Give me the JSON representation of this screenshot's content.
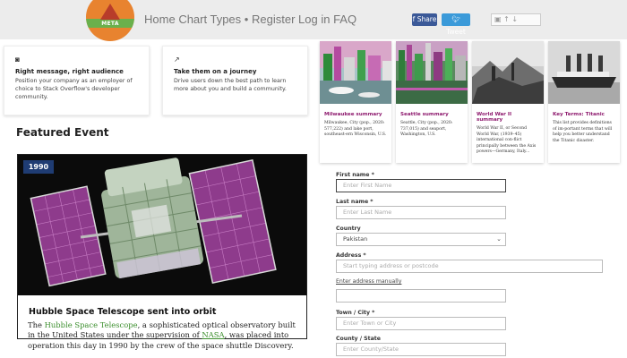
{
  "header": {
    "logo_text": "META",
    "nav": [
      "Home",
      "Chart Types",
      "Register",
      "Log in",
      "FAQ"
    ],
    "share_facebook": "Share",
    "share_twitter": "Tweet",
    "mini_widget": "▣ ↑ ↓"
  },
  "ads": [
    {
      "icon": "camera-icon",
      "title": "Right message, right audience",
      "desc": "Position your company as an employer of choice to Stack Overflow's developer community."
    },
    {
      "icon": "trend-icon",
      "title": "Take them on a journey",
      "desc": "Drive users down the best path to learn more about you and build a community."
    }
  ],
  "thumbnails": [
    {
      "caption": "Milwaukee summary",
      "text": "Milwaukee, City (pop., 2020: 577,222) and lake port, southeast-ern Wisconsin, U.S."
    },
    {
      "caption": "Seattle summary",
      "text": "Seattle, City (pop., 2020: 737,015) and seaport, Washington, U.S."
    },
    {
      "caption": "World War II summary",
      "text": "World War II, or Second World War, (1939–45) international con-flict principally between the Axis powers—Germany, Italy..."
    },
    {
      "caption": "Key Terms: Titanic",
      "text": "This list provides definitions of im-portant terms that will help you better understand the Titanic disaster."
    }
  ],
  "featured": {
    "section_title": "Featured Event",
    "year": "1990",
    "headline": "Hubble Space Telescope sent into orbit",
    "body_prefix": "The ",
    "link_hubble": "Hubble Space Telescope",
    "body_mid": ", a sophisticated optical observatory built in the United States under the supervision of ",
    "link_nasa": "NASA",
    "body_suffix": ", was placed into operation this day in 1990 by the crew of the space shuttle Discovery."
  },
  "form": {
    "first_name_label": "First name *",
    "first_name_placeholder": "Enter First Name",
    "last_name_label": "Last name *",
    "last_name_placeholder": "Enter Last Name",
    "country_label": "Country",
    "country_value": "Pakistan",
    "address_label": "Address *",
    "address_placeholder": "Start typing address or postcode",
    "manual_link": "Enter address manually",
    "city_label": "Town / City *",
    "city_placeholder": "Enter Town or City",
    "county_label": "County / State",
    "county_placeholder": "Enter County/State"
  },
  "colors": {
    "brand_orange": "#e8832f",
    "facebook": "#3b5998",
    "twitter": "#3b9ad9",
    "badge": "#1f3c73",
    "caption": "#8e1a6e",
    "link_green": "#3c8f2e"
  }
}
